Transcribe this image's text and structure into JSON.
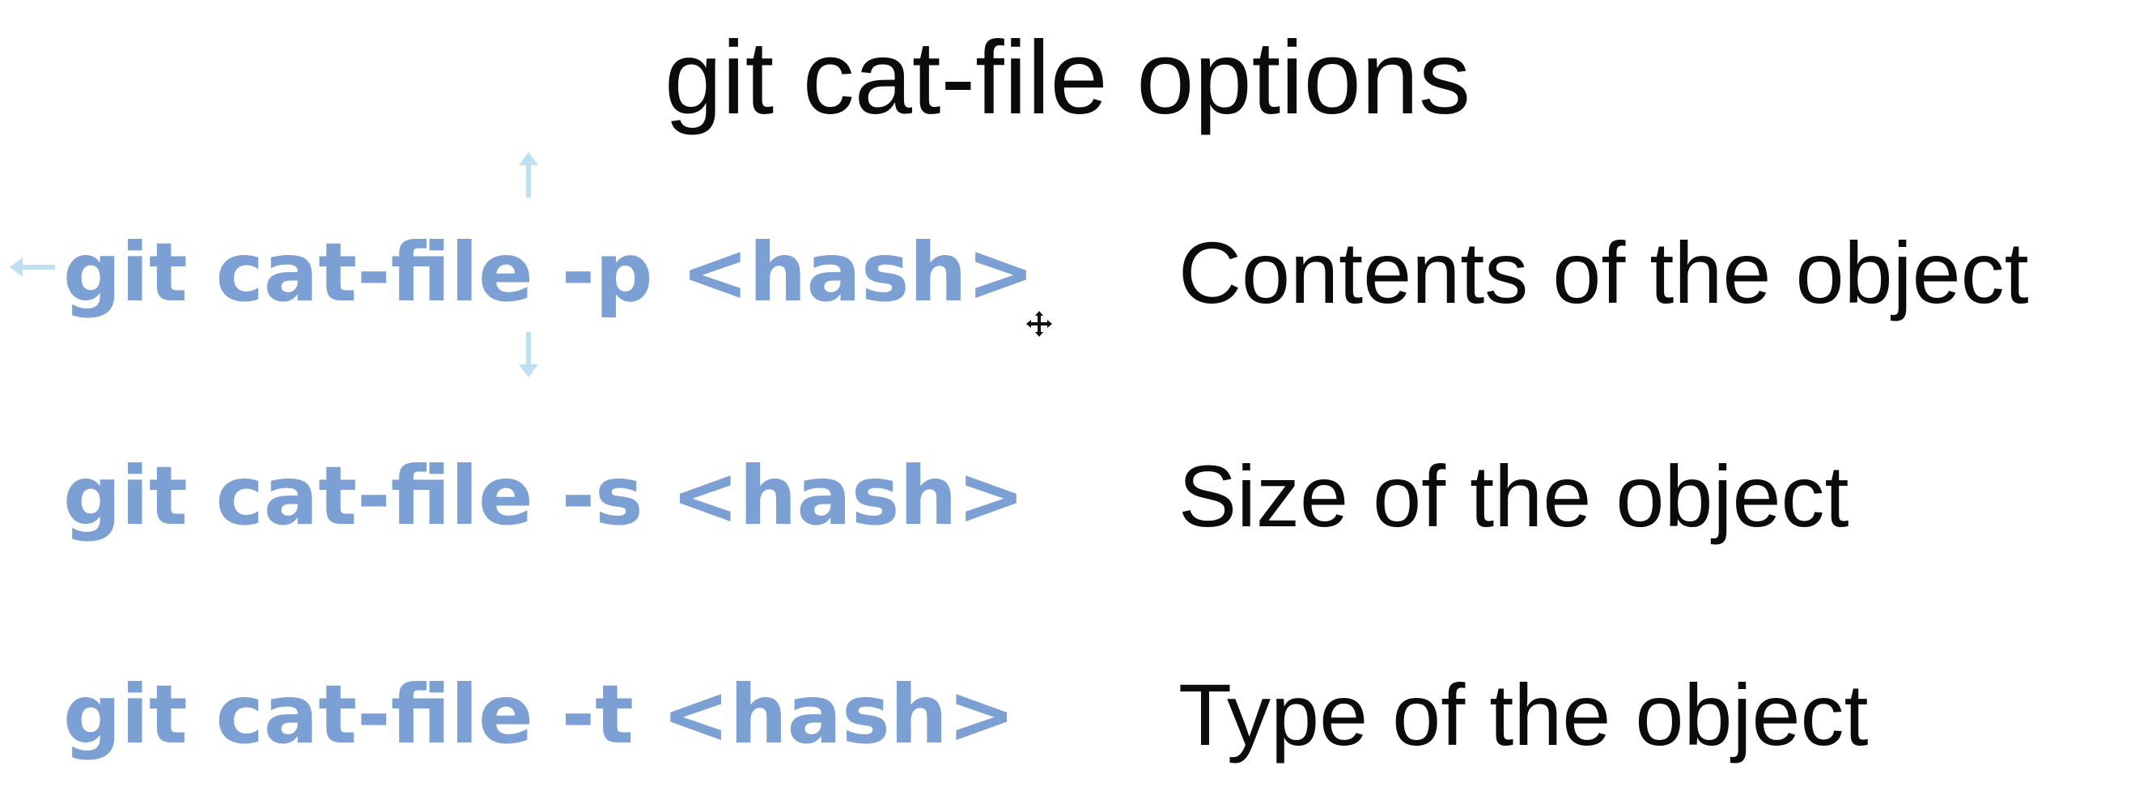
{
  "slide": {
    "title": "git cat-file options",
    "rows": [
      {
        "command": "git cat-file -p <hash>",
        "description": "Contents of the object"
      },
      {
        "command": "git cat-file -s <hash>",
        "description": "Size of the object"
      },
      {
        "command": "git cat-file -t <hash>",
        "description": "Type of the object"
      }
    ]
  },
  "colors": {
    "command": "#7c9fd4",
    "text": "#0b0b0b",
    "handle": "#bfe0f0",
    "background": "#ffffff"
  },
  "icons": {
    "resize_handles": "arrow-handle-icon",
    "cursor": "move-cursor-icon"
  }
}
